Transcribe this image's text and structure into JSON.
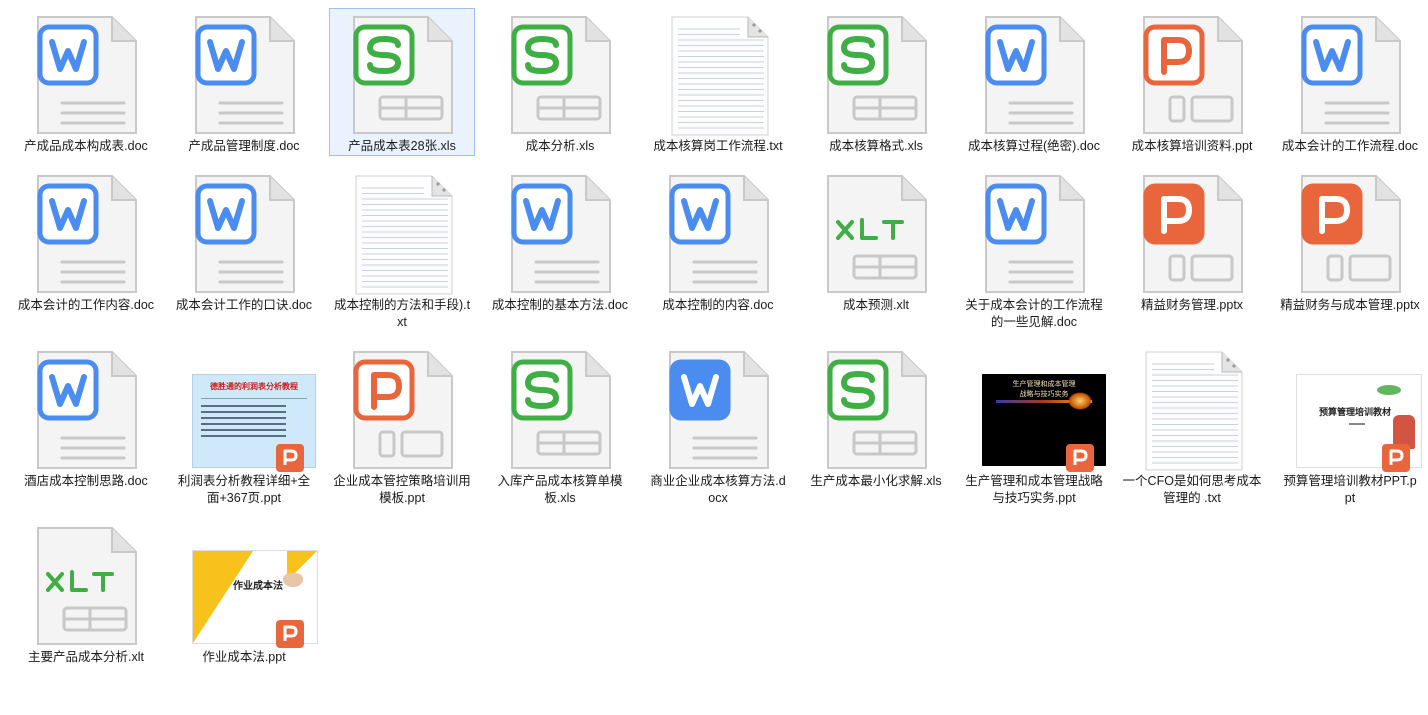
{
  "window": {
    "view": "large-icons",
    "selected_index": 2
  },
  "colors": {
    "word": "#4a8cf0",
    "sheet": "#3fae45",
    "ppt": "#e9663d",
    "page": "#f4f4f4",
    "outline": "#c9c9c9",
    "lines": "#c8c8c8"
  },
  "files": [
    {
      "name": "产成品成本构成表.doc",
      "type": "doc"
    },
    {
      "name": "产成品管理制度.doc",
      "type": "doc"
    },
    {
      "name": "产品成本表28张.xls",
      "type": "xls"
    },
    {
      "name": "成本分析.xls",
      "type": "xls"
    },
    {
      "name": "成本核算岗工作流程.txt",
      "type": "txt"
    },
    {
      "name": "成本核算格式.xls",
      "type": "xls"
    },
    {
      "name": "成本核算过程(绝密).doc",
      "type": "doc"
    },
    {
      "name": "成本核算培训资料.ppt",
      "type": "ppt"
    },
    {
      "name": "成本会计的工作流程.doc",
      "type": "doc"
    },
    {
      "name": "成本会计的工作内容.doc",
      "type": "doc"
    },
    {
      "name": "成本会计工作的口诀.doc",
      "type": "doc"
    },
    {
      "name": "成本控制的方法和手段).txt",
      "type": "txt"
    },
    {
      "name": "成本控制的基本方法.doc",
      "type": "doc"
    },
    {
      "name": "成本控制的内容.doc",
      "type": "doc"
    },
    {
      "name": "成本预测.xlt",
      "type": "xlt"
    },
    {
      "name": "关于成本会计的工作流程的一些见解.doc",
      "type": "doc"
    },
    {
      "name": "精益财务管理.pptx",
      "type": "pptx"
    },
    {
      "name": "精益财务与成本管理.pptx",
      "type": "pptx"
    },
    {
      "name": "酒店成本控制思路.doc",
      "type": "doc"
    },
    {
      "name": "利润表分析教程详细+全面+367页.ppt",
      "type": "thumb1",
      "thumb_title": "德胜通的利润表分析教程"
    },
    {
      "name": "企业成本管控策略培训用模板.ppt",
      "type": "ppt"
    },
    {
      "name": "入库产品成本核算单模板.xls",
      "type": "xls"
    },
    {
      "name": "商业企业成本核算方法.docx",
      "type": "docx"
    },
    {
      "name": "生产成本最小化求解.xls",
      "type": "xls"
    },
    {
      "name": "生产管理和成本管理战略与技巧实务.ppt",
      "type": "thumb2",
      "thumb_title": "生产管理和成本管理",
      "thumb_subtitle": "战略与技巧实务"
    },
    {
      "name": "一个CFO是如何思考成本管理的 .txt",
      "type": "txt"
    },
    {
      "name": "预算管理培训教材PPT.ppt",
      "type": "thumb3",
      "thumb_title": "预算管理培训教材"
    },
    {
      "name": "主要产品成本分析.xlt",
      "type": "xlt"
    },
    {
      "name": "作业成本法.ppt",
      "type": "thumb4",
      "thumb_title": "作业成本法"
    }
  ]
}
